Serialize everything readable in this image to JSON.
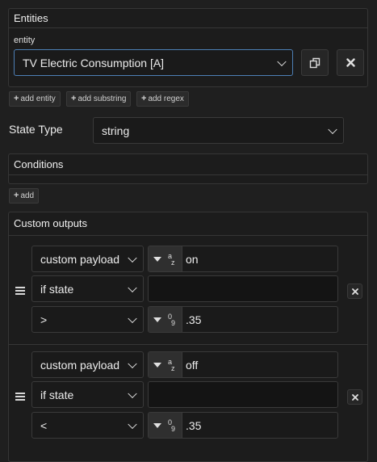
{
  "entities": {
    "title": "Entities",
    "entity_label": "entity",
    "entity_value": "TV Electric Consumption [A]",
    "add_entity": "add entity",
    "add_substring": "add substring",
    "add_regex": "add regex"
  },
  "state_type": {
    "label": "State Type",
    "value": "string"
  },
  "conditions": {
    "title": "Conditions",
    "add": "add"
  },
  "custom_outputs": {
    "title": "Custom outputs",
    "groups": [
      {
        "payload_type": "custom payload",
        "payload_glyph_top": "a",
        "payload_glyph_bottom": "z",
        "payload_value": "on",
        "if_select": "if state",
        "if_value": "",
        "operator": ">",
        "cmp_glyph_top": "0",
        "cmp_glyph_bottom": "9",
        "cmp_value": ".35"
      },
      {
        "payload_type": "custom payload",
        "payload_glyph_top": "a",
        "payload_glyph_bottom": "z",
        "payload_value": "off",
        "if_select": "if state",
        "if_value": "",
        "operator": "<",
        "cmp_glyph_top": "0",
        "cmp_glyph_bottom": "9",
        "cmp_value": ".35"
      }
    ]
  },
  "icons": {
    "copy": "copy-icon",
    "remove": "close-icon",
    "drag": "drag-handle-icon",
    "dropdown": "chevron-down-icon",
    "type_caret": "caret-down-icon"
  }
}
